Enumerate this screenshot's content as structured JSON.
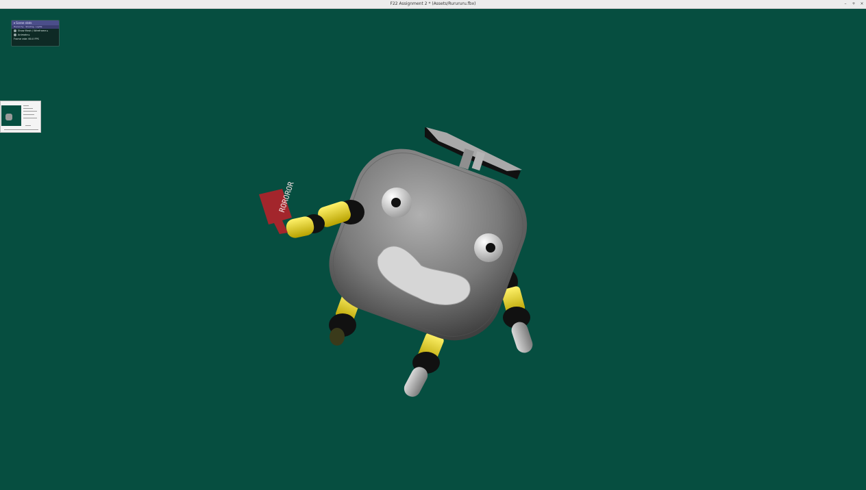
{
  "window": {
    "title": "F22 Assignment 2 * (Assets/Rurururu.fbx)",
    "controls": [
      "minimize",
      "maximize",
      "close"
    ]
  },
  "overlay_panel": {
    "header": "▾ Scene stats",
    "menu": "Hierarchy  ·  Shading  ·  Lights",
    "rows": [
      {
        "icon": "circle-icon",
        "label": "Show Mesh / Wireframe  ▸"
      },
      {
        "icon": "circle-icon",
        "label": "Animate  ▸"
      },
      {
        "icon": "",
        "label": "Frame rate: 60.0 FPS"
      }
    ]
  },
  "scene": {
    "background_color": "#064e40",
    "sign_text": "ROROROR",
    "body_color": "#8c8c8c",
    "limb_accent_color": "#e6d214",
    "joint_color": "#1a1a1a",
    "sign_color": "#a3262c"
  }
}
